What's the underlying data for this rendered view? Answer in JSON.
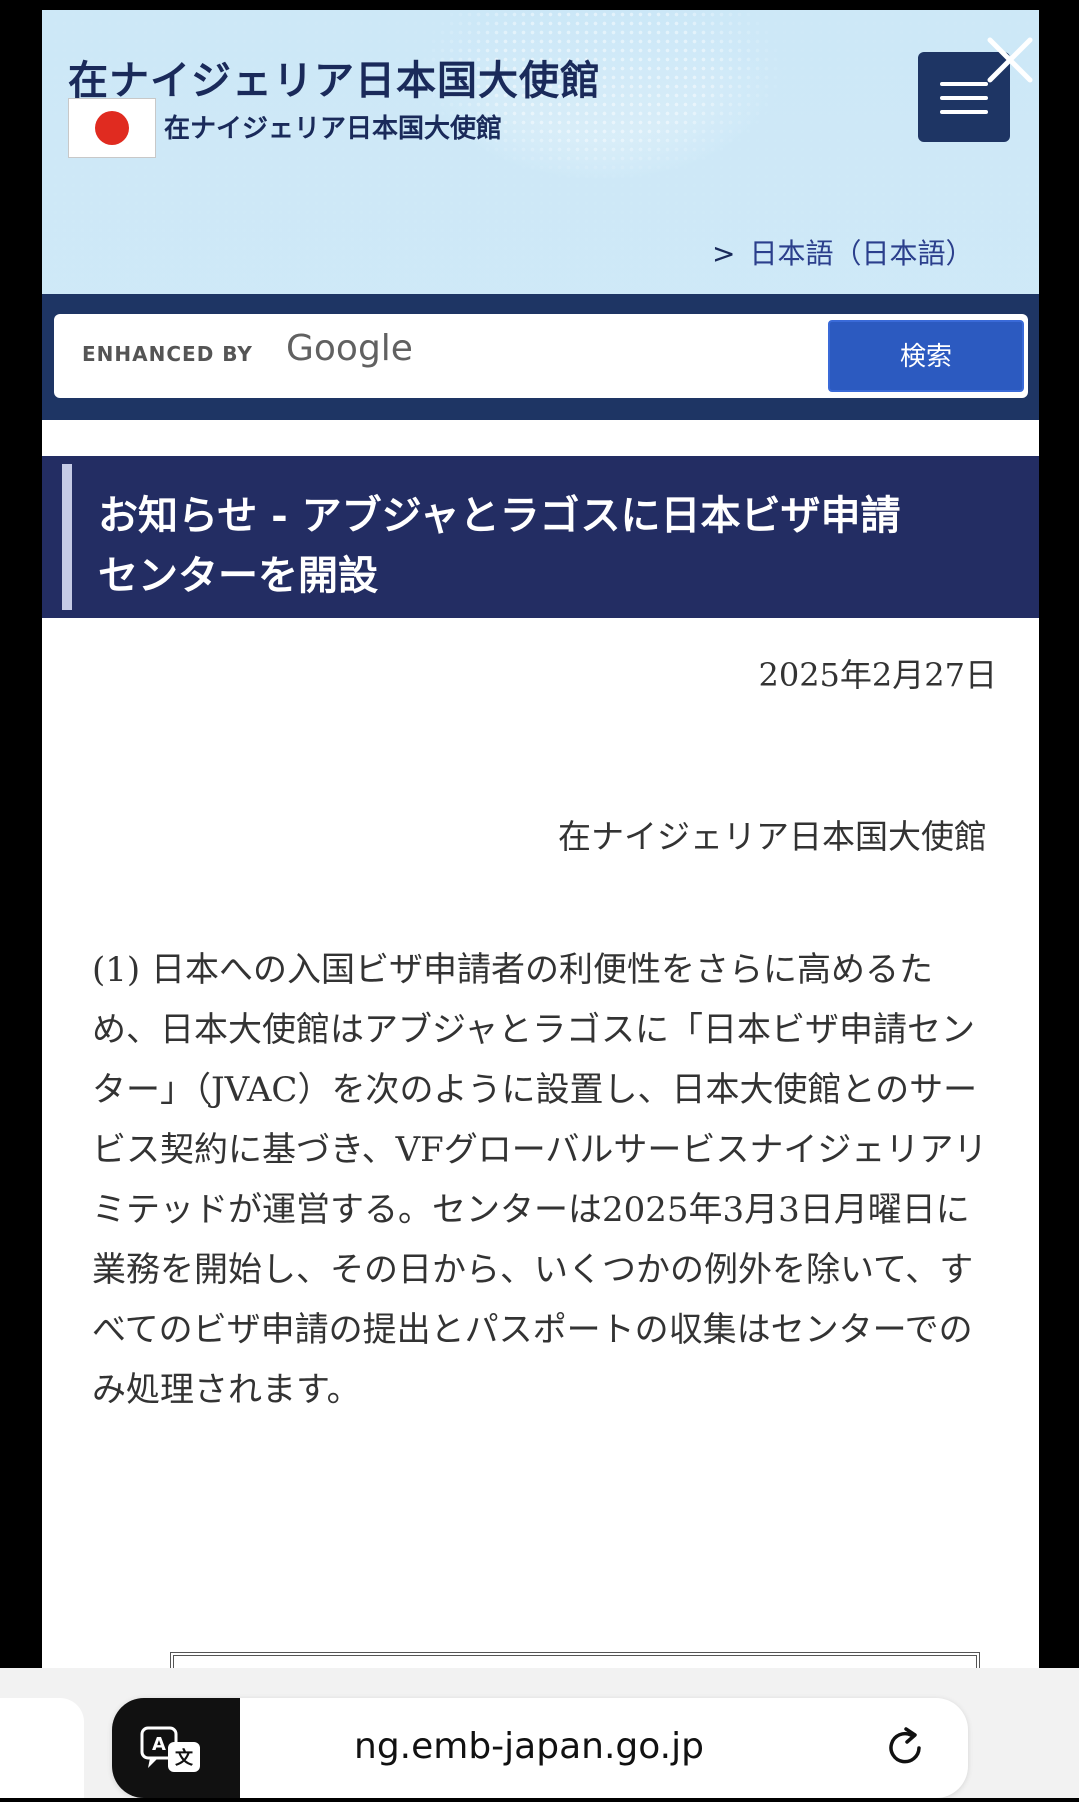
{
  "header": {
    "site_title": "在ナイジェリア日本国大使館",
    "site_subtitle": "在ナイジェリア日本国大使館",
    "language_arrow": ">",
    "language_link": "日本語（日本語）",
    "icons": [
      "japan-flag-icon",
      "hamburger-menu-icon",
      "close-icon"
    ]
  },
  "search": {
    "enhanced_by": "ENHANCED BY",
    "provider": "Google",
    "button_label": "検索",
    "value": ""
  },
  "article": {
    "heading": "お知らせ - アブジャとラゴスに日本ビザ申請センターを開設",
    "date": "2025年2月27日",
    "organization": "在ナイジェリア日本国大使館",
    "paragraph_1": "(1) 日本への入国ビザ申請者の利便性をさらに高めるため、日本大使館はアブジャとラゴスに「日本ビザ申請センター」（JVAC）を次のように設置し、日本大使館とのサービス契約に基づき、VFグローバルサービスナイジェリアリミテッドが運営する。センターは2025年3月3日月曜日に業務を開始し、その日から、いくつかの例外を除いて、すべてのビザ申請の提出とパスポートの収集はセンターでのみ処理されます。"
  },
  "browser": {
    "url": "ng.emb-japan.go.jp",
    "icons": [
      "translate-icon",
      "reload-icon"
    ]
  },
  "colors": {
    "navy": "#1e3564",
    "heading_bg": "#232d63",
    "search_button": "#2c5ac0",
    "flag_red": "#e02b20",
    "link_blue": "#2b3f8c"
  }
}
